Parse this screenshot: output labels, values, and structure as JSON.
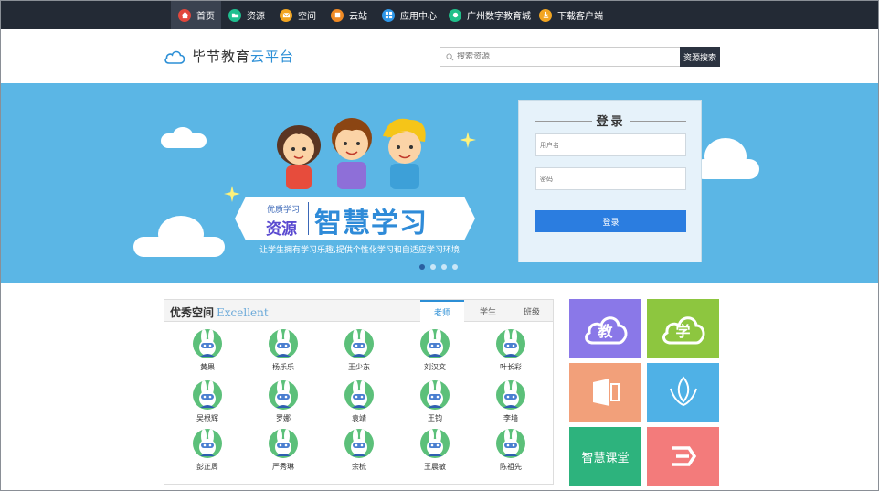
{
  "nav": {
    "items": [
      {
        "label": "首页",
        "icon": "home-icon",
        "color": "#e2473c"
      },
      {
        "label": "资源",
        "icon": "folder-icon",
        "color": "#1fbf8f"
      },
      {
        "label": "空间",
        "icon": "mail-icon",
        "color": "#f2a521"
      },
      {
        "label": "云站",
        "icon": "station-icon",
        "color": "#f08a24"
      },
      {
        "label": "应用中心",
        "icon": "apps-icon",
        "color": "#2e97e8"
      },
      {
        "label": "广州数字教育城",
        "icon": "city-icon",
        "color": "#20c08a"
      },
      {
        "label": "下载客户端",
        "icon": "download-icon",
        "color": "#f2a521"
      }
    ]
  },
  "header": {
    "logo_text": "毕节教育",
    "logo_text_blue": "云平台",
    "search_placeholder": "搜索资源",
    "search_button": "资源搜索"
  },
  "banner": {
    "tag_small": "优质学习",
    "tag_big": "资源",
    "tag_main": "智慧学习",
    "slogan": "让学生拥有学习乐趣,提供个性化学习和自适应学习环境",
    "slides": 4,
    "active_slide": 1
  },
  "login": {
    "title": "登录",
    "username_placeholder": "用户名",
    "password_placeholder": "密码",
    "button": "登录"
  },
  "excellent": {
    "title": "优秀空间",
    "title_en": "Excellent",
    "tabs": [
      "老师",
      "学生",
      "班级"
    ],
    "active_tab": 0,
    "users": [
      "黄果",
      "杨乐乐",
      "王少东",
      "刘汉文",
      "叶长彩",
      "吴根辉",
      "罗娜",
      "袁靖",
      "王钧",
      "李墙",
      "彭正周",
      "严秀琳",
      "余梳",
      "王晨敏",
      "陈祖先"
    ]
  },
  "tiles": [
    {
      "name": "teach-tile",
      "label": "教",
      "color": "#8a78e8"
    },
    {
      "name": "learn-tile",
      "label": "学",
      "color": "#8dc63f"
    },
    {
      "name": "office-tile",
      "label": "",
      "color": "#f2a07a"
    },
    {
      "name": "leaf-tile",
      "label": "",
      "color": "#4fb1e6"
    },
    {
      "name": "smart-class-tile",
      "label": "智慧课堂",
      "color": "#2db37d"
    },
    {
      "name": "arrow-tile",
      "label": "",
      "color": "#f37b7b"
    }
  ]
}
